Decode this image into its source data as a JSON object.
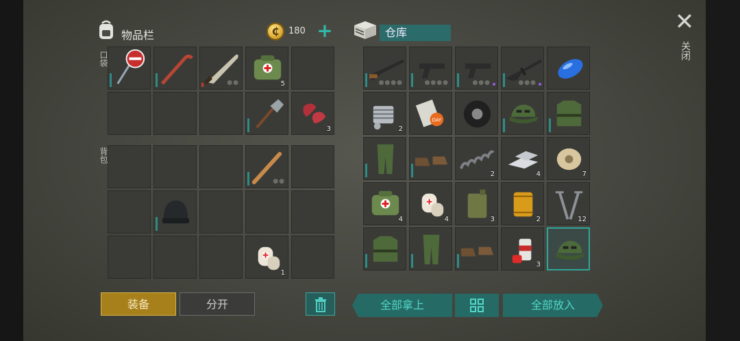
{
  "inventory": {
    "title": "物品栏",
    "coins": "180",
    "pocket_label": "口袋",
    "backpack_label": "背包",
    "pocket_slots": [
      {
        "name": "stop-sign",
        "qty": "",
        "dura": true
      },
      {
        "name": "crowbar",
        "qty": "",
        "dura": true
      },
      {
        "name": "machete",
        "qty": "",
        "dura": false,
        "dots": "●●",
        "redbar": true
      },
      {
        "name": "first-aid-bag",
        "qty": "5",
        "dura": false
      },
      {
        "name": "",
        "qty": ""
      },
      {
        "name": "",
        "qty": ""
      },
      {
        "name": "",
        "qty": ""
      },
      {
        "name": "",
        "qty": ""
      },
      {
        "name": "shovel",
        "qty": "",
        "dura": true
      },
      {
        "name": "raw-meat",
        "qty": "3",
        "dura": false
      }
    ],
    "backpack_slots": [
      {
        "name": "",
        "qty": ""
      },
      {
        "name": "",
        "qty": ""
      },
      {
        "name": "",
        "qty": ""
      },
      {
        "name": "baseball-bat",
        "qty": "",
        "dura": true,
        "dots": "●●"
      },
      {
        "name": "",
        "qty": ""
      },
      {
        "name": "",
        "qty": ""
      },
      {
        "name": "beanie-hat",
        "qty": "",
        "dura": true
      },
      {
        "name": "",
        "qty": ""
      },
      {
        "name": "",
        "qty": ""
      },
      {
        "name": "",
        "qty": ""
      },
      {
        "name": "",
        "qty": ""
      },
      {
        "name": "",
        "qty": ""
      },
      {
        "name": "",
        "qty": ""
      },
      {
        "name": "bandage",
        "qty": "1",
        "dura": false
      },
      {
        "name": "",
        "qty": ""
      }
    ]
  },
  "warehouse": {
    "title": "仓库",
    "slots": [
      {
        "name": "shotgun",
        "qty": "",
        "dura": true,
        "dots": "●●●●"
      },
      {
        "name": "pistol",
        "qty": "",
        "dura": true,
        "dots": "●●●●"
      },
      {
        "name": "pistol",
        "qty": "",
        "dura": true,
        "dots": "●●●",
        "purple": true
      },
      {
        "name": "assault-rifle",
        "qty": "",
        "dura": true,
        "dots": "●●●",
        "purple": true
      },
      {
        "name": "blue-fuel-tank",
        "qty": ""
      },
      {
        "name": "engine-part",
        "qty": "2"
      },
      {
        "name": "magazine",
        "qty": ""
      },
      {
        "name": "tire",
        "qty": ""
      },
      {
        "name": "camo-cap",
        "qty": "",
        "dura": true
      },
      {
        "name": "camo-jacket",
        "qty": "",
        "dura": true
      },
      {
        "name": "camo-pants",
        "qty": "",
        "dura": true
      },
      {
        "name": "boots",
        "qty": "",
        "dura": true
      },
      {
        "name": "spring",
        "qty": "2"
      },
      {
        "name": "metal-bars",
        "qty": "4"
      },
      {
        "name": "wire-spool",
        "qty": "7"
      },
      {
        "name": "first-aid-bag",
        "qty": "4"
      },
      {
        "name": "bandage",
        "qty": "4"
      },
      {
        "name": "jerry-can",
        "qty": "3"
      },
      {
        "name": "oil-filter",
        "qty": "2"
      },
      {
        "name": "nails",
        "qty": "12"
      },
      {
        "name": "camo-jacket",
        "qty": "",
        "dura": true
      },
      {
        "name": "camo-pants",
        "qty": "",
        "dura": true
      },
      {
        "name": "boots",
        "qty": "",
        "dura": true
      },
      {
        "name": "spray-paint",
        "qty": "3"
      },
      {
        "name": "camo-cap",
        "qty": "",
        "active": true
      }
    ]
  },
  "buttons": {
    "equip": "装备",
    "split": "分开",
    "take_all": "全部拿上",
    "put_all": "全部放入",
    "close": "关闭"
  },
  "icons": {
    "backpack": "backpack-icon",
    "coin": "coin-icon",
    "plus": "plus-icon",
    "warehouse": "storage-box-icon",
    "close": "close-icon",
    "trash": "trash-icon",
    "grid": "grid-icon"
  }
}
